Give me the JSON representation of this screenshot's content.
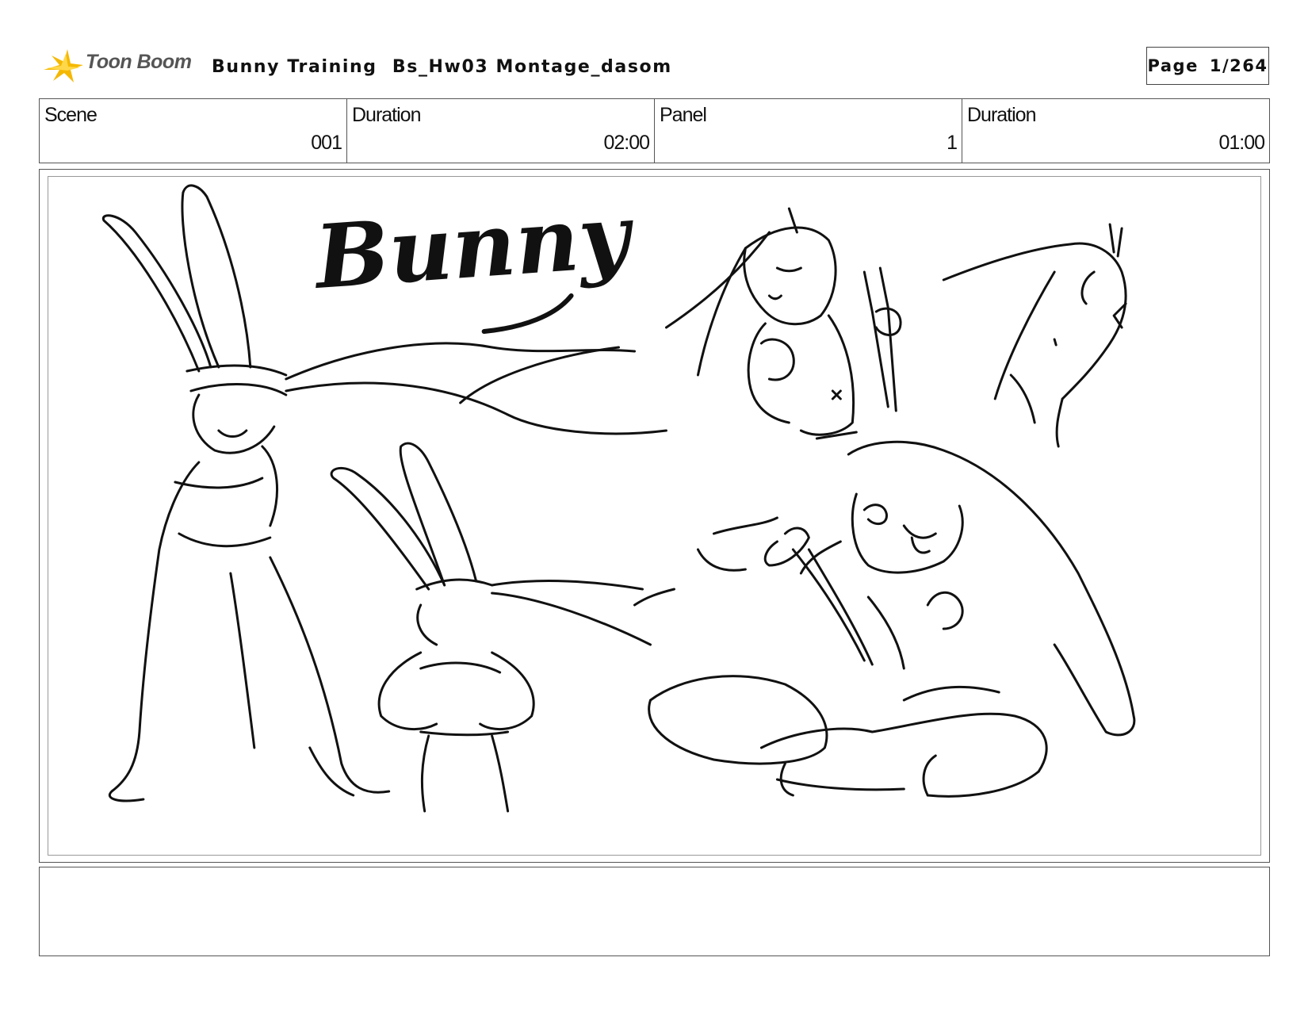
{
  "header": {
    "logo_text": "Toon Boom",
    "project_title": "Bunny Training",
    "sequence_title": "Bs_Hw03 Montage_dasom",
    "page_label": "Page",
    "page_value": "1/264"
  },
  "info": {
    "scene_label": "Scene",
    "scene_value": "001",
    "scene_duration_label": "Duration",
    "scene_duration_value": "02:00",
    "panel_label": "Panel",
    "panel_value": "1",
    "panel_duration_label": "Duration",
    "panel_duration_value": "01:00"
  },
  "panel": {
    "sketch_title": "Bunny"
  },
  "notes": {
    "text": ""
  },
  "colors": {
    "logo_accent": "#f5b800",
    "logo_text": "#555555",
    "border": "#555555"
  }
}
